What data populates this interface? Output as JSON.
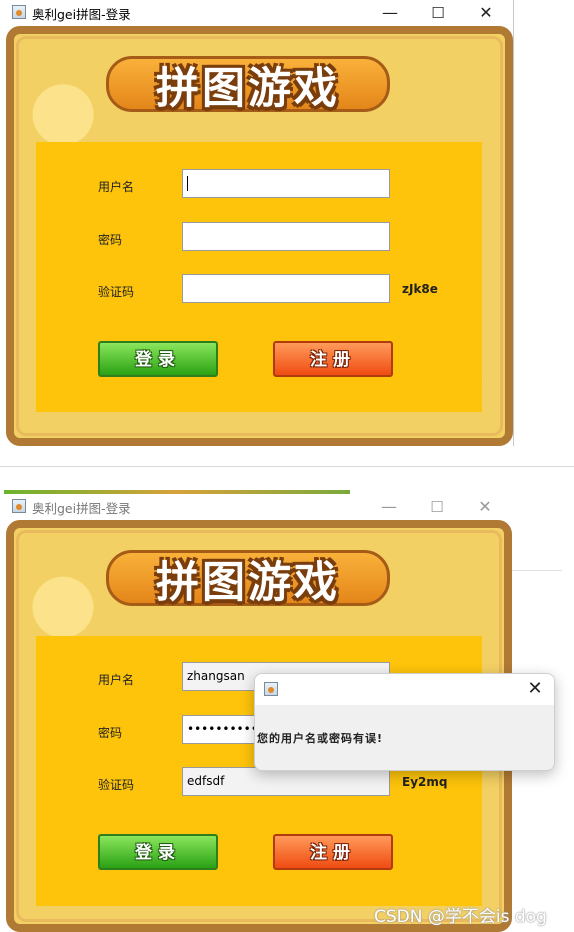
{
  "window1": {
    "title": "奥利gei拼图-登录",
    "banner_text": "拼图游戏",
    "labels": {
      "username": "用户名",
      "password": "密码",
      "captcha": "验证码"
    },
    "values": {
      "username": "",
      "password": "",
      "captcha": ""
    },
    "captcha_code": "zJk8e",
    "buttons": {
      "login": "登录",
      "register": "注册"
    },
    "controls": {
      "minimize": "—",
      "maximize": "☐",
      "close": "✕"
    }
  },
  "window2": {
    "title": "奥利gei拼图-登录",
    "banner_text": "拼图游戏",
    "labels": {
      "username": "用户名",
      "password": "密码",
      "captcha": "验证码"
    },
    "values": {
      "username": "zhangsan",
      "password": "••••••••••",
      "captcha": "edfsdf"
    },
    "captcha_code": "Ey2mq",
    "buttons": {
      "login": "登录",
      "register": "注册"
    },
    "controls": {
      "minimize": "—",
      "maximize": "☐",
      "close": "✕"
    }
  },
  "dialog": {
    "message": "您的用户名或密码有误!",
    "close": "✕"
  },
  "watermark": "CSDN @学不会is dog"
}
